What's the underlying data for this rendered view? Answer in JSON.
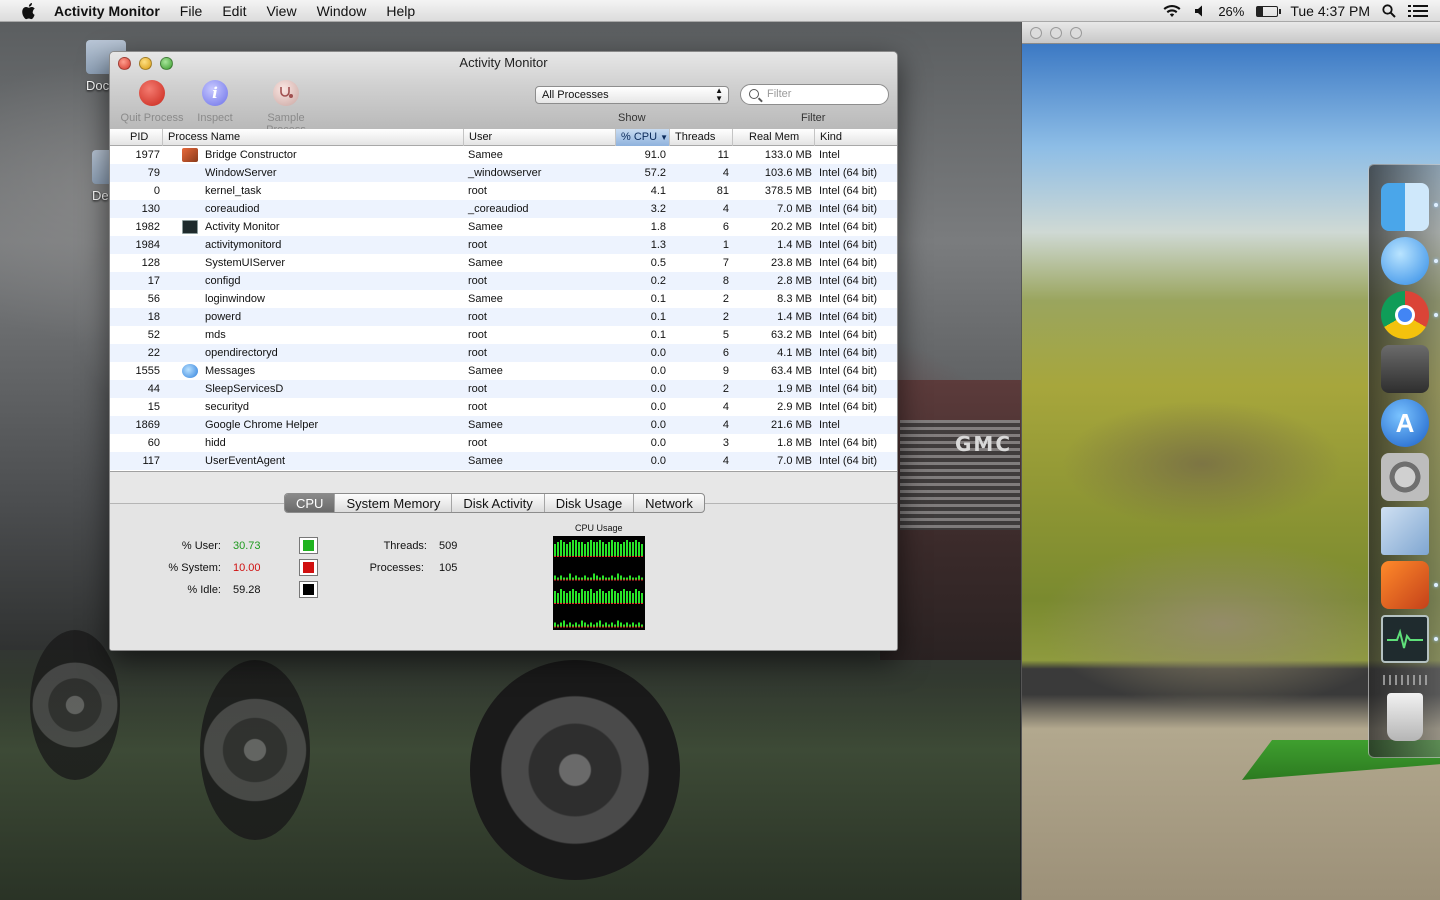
{
  "menubar": {
    "app_name": "Activity Monitor",
    "menus": [
      "File",
      "Edit",
      "View",
      "Window",
      "Help"
    ],
    "battery_percent": "26%",
    "clock": "Tue 4:37 PM"
  },
  "desktop": {
    "icons": [
      "Doc",
      "De"
    ],
    "truck_badge": "GMC"
  },
  "window": {
    "title": "Activity Monitor",
    "toolbar": {
      "quit_label": "Quit Process",
      "inspect_label": "Inspect",
      "sample_label": "Sample Process",
      "show_value": "All Processes",
      "show_label": "Show",
      "filter_placeholder": "Filter",
      "filter_label": "Filter"
    },
    "columns": [
      "PID",
      "Process Name",
      "User",
      "% CPU",
      "Threads",
      "Real Mem",
      "Kind"
    ],
    "sorted_column": "% CPU",
    "processes": [
      {
        "pid": "1977",
        "name": "Bridge Constructor",
        "user": "Samee",
        "cpu": "91.0",
        "threads": "11",
        "mem": "133.0 MB",
        "kind": "Intel",
        "icon": "bridge-constructor-icon"
      },
      {
        "pid": "79",
        "name": "WindowServer",
        "user": "_windowserver",
        "cpu": "57.2",
        "threads": "4",
        "mem": "103.6 MB",
        "kind": "Intel (64 bit)",
        "icon": ""
      },
      {
        "pid": "0",
        "name": "kernel_task",
        "user": "root",
        "cpu": "4.1",
        "threads": "81",
        "mem": "378.5 MB",
        "kind": "Intel (64 bit)",
        "icon": ""
      },
      {
        "pid": "130",
        "name": "coreaudiod",
        "user": "_coreaudiod",
        "cpu": "3.2",
        "threads": "4",
        "mem": "7.0 MB",
        "kind": "Intel (64 bit)",
        "icon": ""
      },
      {
        "pid": "1982",
        "name": "Activity Monitor",
        "user": "Samee",
        "cpu": "1.8",
        "threads": "6",
        "mem": "20.2 MB",
        "kind": "Intel (64 bit)",
        "icon": "activity-monitor-icon"
      },
      {
        "pid": "1984",
        "name": "activitymonitord",
        "user": "root",
        "cpu": "1.3",
        "threads": "1",
        "mem": "1.4 MB",
        "kind": "Intel (64 bit)",
        "icon": ""
      },
      {
        "pid": "128",
        "name": "SystemUIServer",
        "user": "Samee",
        "cpu": "0.5",
        "threads": "7",
        "mem": "23.8 MB",
        "kind": "Intel (64 bit)",
        "icon": ""
      },
      {
        "pid": "17",
        "name": "configd",
        "user": "root",
        "cpu": "0.2",
        "threads": "8",
        "mem": "2.8 MB",
        "kind": "Intel (64 bit)",
        "icon": ""
      },
      {
        "pid": "56",
        "name": "loginwindow",
        "user": "Samee",
        "cpu": "0.1",
        "threads": "2",
        "mem": "8.3 MB",
        "kind": "Intel (64 bit)",
        "icon": ""
      },
      {
        "pid": "18",
        "name": "powerd",
        "user": "root",
        "cpu": "0.1",
        "threads": "2",
        "mem": "1.4 MB",
        "kind": "Intel (64 bit)",
        "icon": ""
      },
      {
        "pid": "52",
        "name": "mds",
        "user": "root",
        "cpu": "0.1",
        "threads": "5",
        "mem": "63.2 MB",
        "kind": "Intel (64 bit)",
        "icon": ""
      },
      {
        "pid": "22",
        "name": "opendirectoryd",
        "user": "root",
        "cpu": "0.0",
        "threads": "6",
        "mem": "4.1 MB",
        "kind": "Intel (64 bit)",
        "icon": ""
      },
      {
        "pid": "1555",
        "name": "Messages",
        "user": "Samee",
        "cpu": "0.0",
        "threads": "9",
        "mem": "63.4 MB",
        "kind": "Intel (64 bit)",
        "icon": "messages-icon"
      },
      {
        "pid": "44",
        "name": "SleepServicesD",
        "user": "root",
        "cpu": "0.0",
        "threads": "2",
        "mem": "1.9 MB",
        "kind": "Intel (64 bit)",
        "icon": ""
      },
      {
        "pid": "15",
        "name": "securityd",
        "user": "root",
        "cpu": "0.0",
        "threads": "4",
        "mem": "2.9 MB",
        "kind": "Intel (64 bit)",
        "icon": ""
      },
      {
        "pid": "1869",
        "name": "Google Chrome Helper",
        "user": "Samee",
        "cpu": "0.0",
        "threads": "4",
        "mem": "21.6 MB",
        "kind": "Intel",
        "icon": ""
      },
      {
        "pid": "60",
        "name": "hidd",
        "user": "root",
        "cpu": "0.0",
        "threads": "3",
        "mem": "1.8 MB",
        "kind": "Intel (64 bit)",
        "icon": ""
      },
      {
        "pid": "117",
        "name": "UserEventAgent",
        "user": "Samee",
        "cpu": "0.0",
        "threads": "4",
        "mem": "7.0 MB",
        "kind": "Intel (64 bit)",
        "icon": ""
      }
    ],
    "tabs": [
      "CPU",
      "System Memory",
      "Disk Activity",
      "Disk Usage",
      "Network"
    ],
    "active_tab": "CPU",
    "cpu_stats": {
      "user_label": "% User:",
      "user_value": "30.73",
      "system_label": "% System:",
      "system_value": "10.00",
      "idle_label": "% Idle:",
      "idle_value": "59.28",
      "threads_label": "Threads:",
      "threads_value": "509",
      "processes_label": "Processes:",
      "processes_value": "105",
      "graph_label": "CPU Usage"
    },
    "colors": {
      "user": "#1fb31f",
      "system": "#d01010",
      "idle": "#000000",
      "graph_user": "#29e629",
      "graph_system": "#e62929"
    }
  },
  "dock": {
    "items": [
      "finder-icon",
      "messages-icon",
      "chrome-icon",
      "facetime-icon",
      "app-store-icon",
      "system-preferences-icon",
      "mail-icon",
      "bridge-constructor-icon",
      "activity-monitor-icon",
      "trash-icon"
    ]
  }
}
